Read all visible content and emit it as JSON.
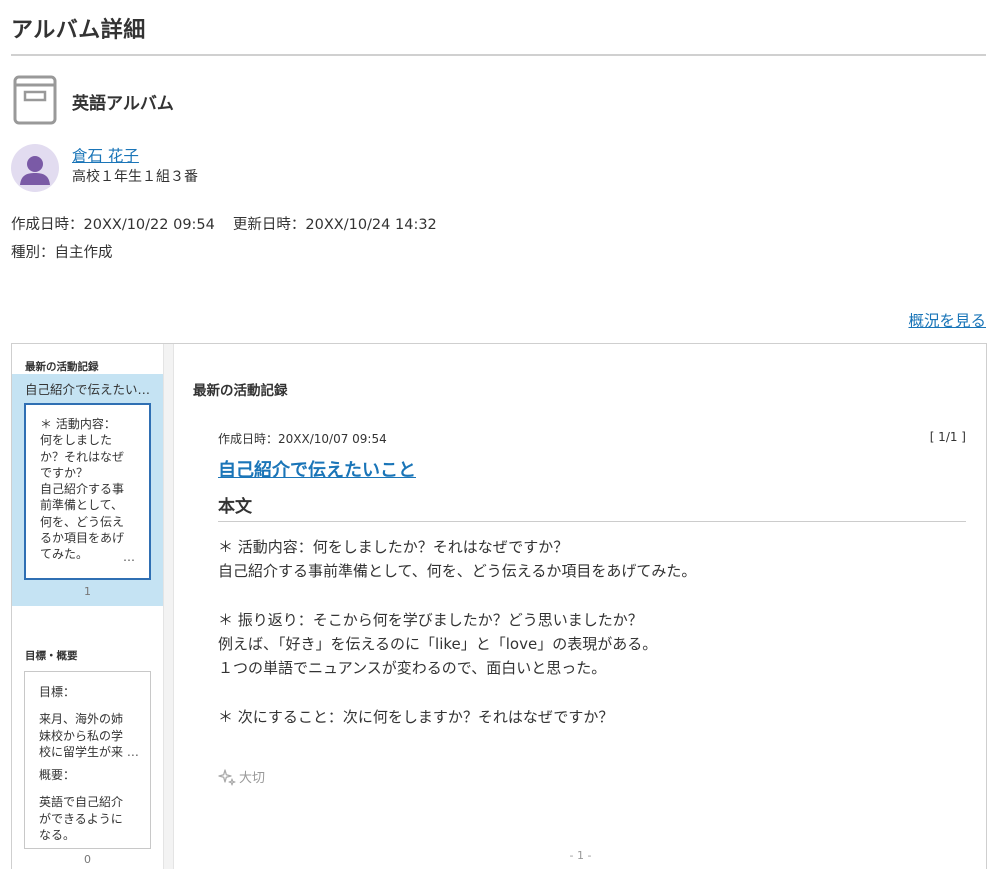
{
  "page": {
    "title": "アルバム詳細"
  },
  "album": {
    "name": "英語アルバム",
    "icon": "album-book-icon"
  },
  "owner": {
    "name": "倉石 花子",
    "class_info": "高校１年生１組３番",
    "avatar_icon": "user-avatar-icon"
  },
  "meta": {
    "created": "作成日時：20XX/10/22 09:54",
    "updated": "更新日時：20XX/10/24 14:32",
    "type": "種別：自主作成"
  },
  "overview_link": "概況を見る",
  "sidebar": {
    "latest_heading": "最新の活動記録",
    "selected_item": {
      "title": "自己紹介で伝えたいこと",
      "preview_lines": [
        "＊ 活動内容：",
        "何をしました",
        "か？それはなぜ",
        "ですか？",
        "自己紹介する事",
        "前準備として、",
        "何を、どう伝え",
        "るか項目をあげ",
        "てみた。"
      ],
      "ellipsis": "…",
      "count": "1"
    },
    "goals_heading": "目標・概要",
    "goals_card": {
      "goal_label": "目標：",
      "goal_lines": [
        "来月、海外の姉",
        "妹校から私の学",
        "校に留学生が来"
      ],
      "goal_ellipsis": "…",
      "summary_label": "概要：",
      "summary_lines": [
        "英語で自己紹介",
        "ができるように",
        "なる。"
      ],
      "count": "0"
    }
  },
  "main": {
    "heading": "最新の活動記録",
    "entry": {
      "date": "作成日時：20XX/10/07 09:54",
      "page_indicator": "[ 1/1 ]",
      "title": "自己紹介で伝えたいこと",
      "body_label": "本文",
      "body_lines": [
        "＊ 活動内容：何をしましたか？それはなぜですか？",
        "自己紹介する事前準備として、何を、どう伝えるか項目をあげてみた。",
        "",
        "＊ 振り返り：そこから何を学びましたか？どう思いましたか？",
        "例えば、「好き」を伝えるのに「like」と「love」の表現がある。",
        "１つの単語でニュアンスが変わるので、面白いと思った。",
        "",
        "＊ 次にすること：次に何をしますか？それはなぜですか？"
      ],
      "important_label": "大切",
      "important_icon": "sparkle-icon"
    },
    "pager": "- 1 -"
  },
  "colors": {
    "link": "#1a75b8",
    "selected_bg": "#c5e3f3",
    "selected_border": "#2f6fb3",
    "avatar_bg": "#e2dcf0",
    "avatar_fg": "#7a5aa6"
  }
}
